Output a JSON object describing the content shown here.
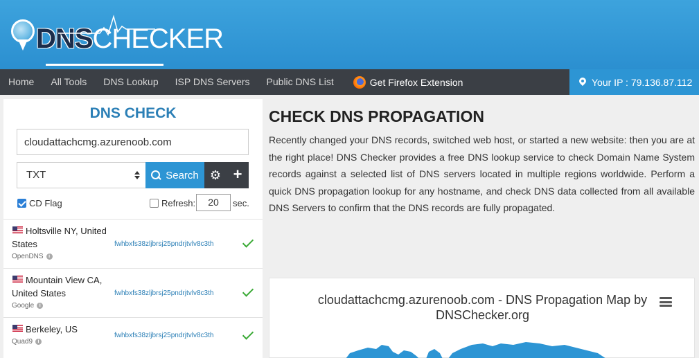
{
  "header": {
    "logo_dns": "DNS",
    "logo_checker": "CHECKER"
  },
  "nav": {
    "items": [
      "Home",
      "All Tools",
      "DNS Lookup",
      "ISP DNS Servers",
      "Public DNS List"
    ],
    "extension": "Get Firefox Extension",
    "ip": "Your IP : 79.136.87.112"
  },
  "form": {
    "title": "DNS CHECK",
    "domain": "cloudattachcmg.azurenoob.com",
    "record_type": "TXT",
    "search_label": "Search",
    "cd_flag_label": "CD Flag",
    "cd_flag_checked": true,
    "refresh_label": "Refresh:",
    "refresh_checked": false,
    "refresh_value": "20",
    "sec_label": "sec."
  },
  "results": [
    {
      "location": "Holtsville NY, United States",
      "provider": "OpenDNS",
      "value": "fwhbxfs38zljbrsj25pndrjtvlv8c3th",
      "status": "ok"
    },
    {
      "location": "Mountain View CA, United States",
      "provider": "Google",
      "value": "fwhbxfs38zljbrsj25pndrjtvlv8c3th",
      "status": "ok"
    },
    {
      "location": "Berkeley, US",
      "provider": "Quad9",
      "value": "fwhbxfs38zljbrsj25pndrjtvlv8c3th",
      "status": "ok"
    }
  ],
  "main": {
    "title": "CHECK DNS PROPAGATION",
    "intro": "Recently changed your DNS records, switched web host, or started a new website: then you are at the right place! DNS Checker provides a free DNS lookup service to check Domain Name System records against a selected list of DNS servers located in multiple regions worldwide. Perform a quick DNS propagation lookup for any hostname, and check DNS data collected from all available DNS Servers to confirm that the DNS records are fully propagated.",
    "map_title": "cloudattachcmg.azurenoob.com - DNS Propagation Map by DNSChecker.org"
  },
  "colors": {
    "brand_blue": "#2d95d4",
    "nav_dark": "#3b3f45",
    "success_green": "#3aaa35",
    "title_blue": "#2b7fb6"
  }
}
